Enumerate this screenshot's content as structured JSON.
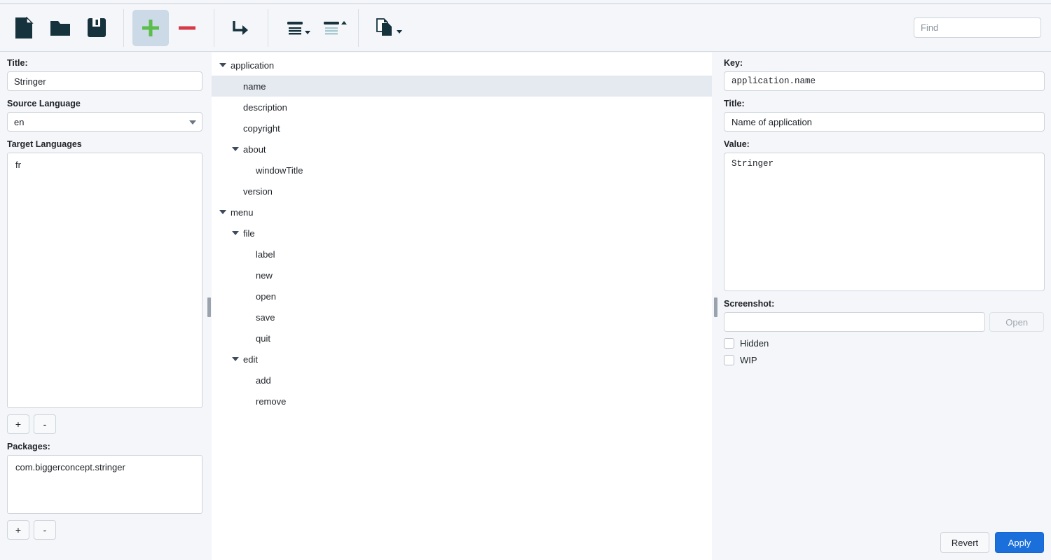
{
  "colors": {
    "accent_blue": "#1a6fdb",
    "icon_dark": "#16323d",
    "add_green": "#5bbd4a",
    "remove_red": "#d63b4a",
    "selection": "#e5e9f0",
    "chrome": "#f4f6f9"
  },
  "toolbar": {
    "buttons": [
      {
        "name": "new-file",
        "icon": "document-icon",
        "tooltip": "New"
      },
      {
        "name": "open-file",
        "icon": "folder-icon",
        "tooltip": "Open"
      },
      {
        "name": "save-file",
        "icon": "floppy-disk-icon",
        "tooltip": "Save"
      },
      {
        "name": "add-entry",
        "icon": "plus-icon",
        "tooltip": "Add",
        "active": true
      },
      {
        "name": "remove-entry",
        "icon": "minus-icon",
        "tooltip": "Remove"
      },
      {
        "name": "move-entry",
        "icon": "arrow-turn-right-icon",
        "tooltip": "Move"
      },
      {
        "name": "collapse-all",
        "icon": "collapse-all-icon",
        "tooltip": "Collapse"
      },
      {
        "name": "expand-all",
        "icon": "expand-all-icon",
        "tooltip": "Expand"
      },
      {
        "name": "duplicate",
        "icon": "copy-pages-icon",
        "tooltip": "Copy"
      }
    ],
    "find_placeholder": "Find",
    "find_value": ""
  },
  "left_panel": {
    "title_label": "Title:",
    "title_value": "Stringer",
    "source_language_label": "Source Language",
    "source_language_value": "en",
    "target_languages_label": "Target Languages",
    "target_languages": [
      "fr"
    ],
    "target_add_label": "+",
    "target_remove_label": "-",
    "packages_label": "Packages:",
    "packages": [
      "com.biggerconcept.stringer"
    ],
    "packages_add_label": "+",
    "packages_remove_label": "-"
  },
  "tree": {
    "selected": "name",
    "nodes": [
      {
        "label": "application",
        "depth": 0,
        "expandable": true,
        "expanded": true,
        "selected": false
      },
      {
        "label": "name",
        "depth": 1,
        "expandable": false,
        "expanded": false,
        "selected": true
      },
      {
        "label": "description",
        "depth": 1,
        "expandable": false,
        "expanded": false,
        "selected": false
      },
      {
        "label": "copyright",
        "depth": 1,
        "expandable": false,
        "expanded": false,
        "selected": false
      },
      {
        "label": "about",
        "depth": 1,
        "expandable": true,
        "expanded": true,
        "selected": false
      },
      {
        "label": "windowTitle",
        "depth": 2,
        "expandable": false,
        "expanded": false,
        "selected": false
      },
      {
        "label": "version",
        "depth": 1,
        "expandable": false,
        "expanded": false,
        "selected": false
      },
      {
        "label": "menu",
        "depth": 0,
        "expandable": true,
        "expanded": true,
        "selected": false
      },
      {
        "label": "file",
        "depth": 1,
        "expandable": true,
        "expanded": true,
        "selected": false
      },
      {
        "label": "label",
        "depth": 2,
        "expandable": false,
        "expanded": false,
        "selected": false
      },
      {
        "label": "new",
        "depth": 2,
        "expandable": false,
        "expanded": false,
        "selected": false
      },
      {
        "label": "open",
        "depth": 2,
        "expandable": false,
        "expanded": false,
        "selected": false
      },
      {
        "label": "save",
        "depth": 2,
        "expandable": false,
        "expanded": false,
        "selected": false
      },
      {
        "label": "quit",
        "depth": 2,
        "expandable": false,
        "expanded": false,
        "selected": false
      },
      {
        "label": "edit",
        "depth": 1,
        "expandable": true,
        "expanded": true,
        "selected": false
      },
      {
        "label": "add",
        "depth": 2,
        "expandable": false,
        "expanded": false,
        "selected": false
      },
      {
        "label": "remove",
        "depth": 2,
        "expandable": false,
        "expanded": false,
        "selected": false
      }
    ]
  },
  "right_panel": {
    "key_label": "Key:",
    "key_value": "application.name",
    "title_label": "Title:",
    "title_value": "Name of application",
    "value_label": "Value:",
    "value_value": "Stringer",
    "screenshot_label": "Screenshot:",
    "screenshot_value": "",
    "open_button_label": "Open",
    "hidden_label": "Hidden",
    "hidden_checked": false,
    "wip_label": "WIP",
    "wip_checked": false,
    "revert_label": "Revert",
    "apply_label": "Apply"
  }
}
